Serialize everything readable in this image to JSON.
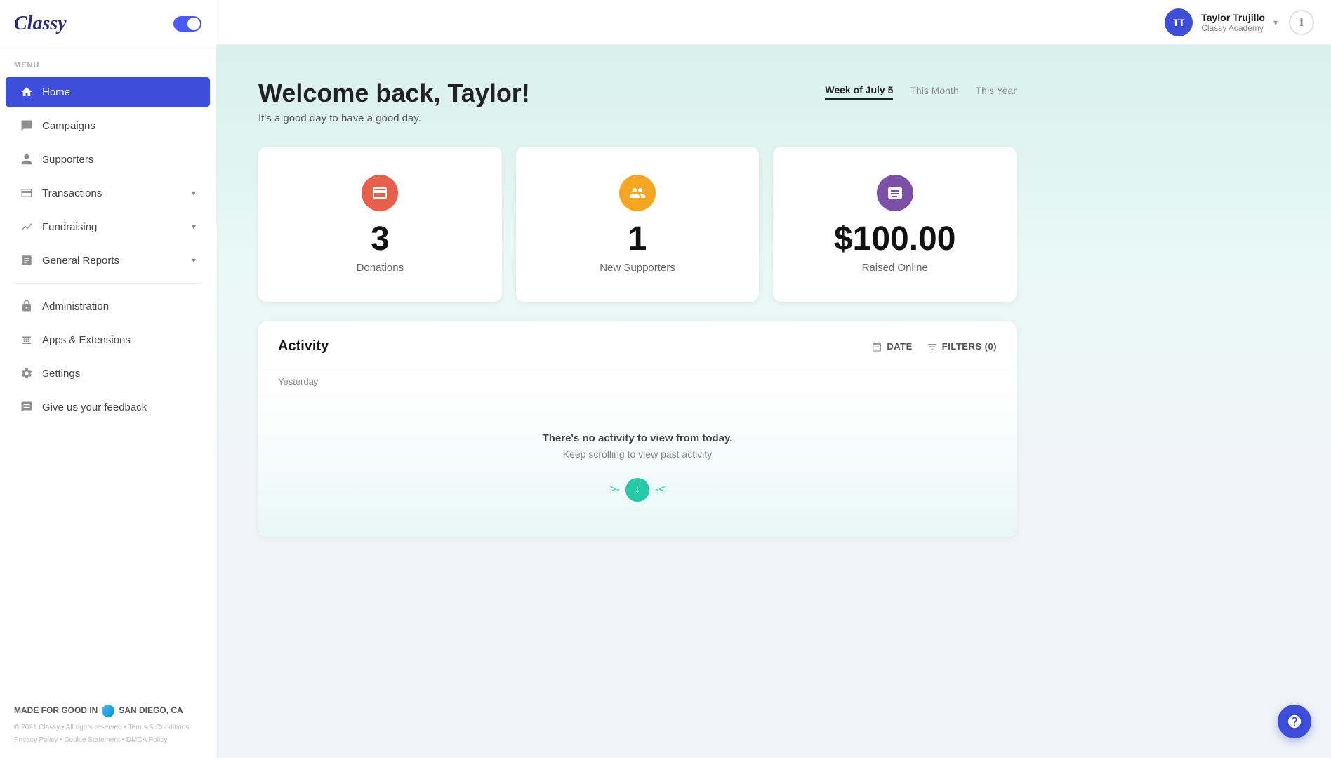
{
  "logo": "Classy",
  "menu_label": "MENU",
  "nav_items": [
    {
      "id": "home",
      "label": "Home",
      "icon": "🏠",
      "active": true
    },
    {
      "id": "campaigns",
      "label": "Campaigns",
      "icon": "📢",
      "active": false
    },
    {
      "id": "supporters",
      "label": "Supporters",
      "icon": "👤",
      "active": false
    },
    {
      "id": "transactions",
      "label": "Transactions",
      "icon": "💳",
      "active": false,
      "has_chevron": true
    },
    {
      "id": "fundraising",
      "label": "Fundraising",
      "icon": "📊",
      "active": false,
      "has_chevron": true
    },
    {
      "id": "general_reports",
      "label": "General Reports",
      "icon": "📄",
      "active": false,
      "has_chevron": true
    }
  ],
  "nav_items_bottom": [
    {
      "id": "administration",
      "label": "Administration",
      "icon": "🔒"
    },
    {
      "id": "apps_extensions",
      "label": "Apps & Extensions",
      "icon": "🔗"
    },
    {
      "id": "settings",
      "label": "Settings",
      "icon": "⚙️"
    },
    {
      "id": "feedback",
      "label": "Give us your feedback",
      "icon": "💬"
    }
  ],
  "footer": {
    "made_for": "MADE FOR GOOD IN",
    "location": "SAN DIEGO, CA",
    "copyright": "© 2021 Classy  •  All rights reserved  •  Terms & Conditions",
    "links": "Privacy Policy  •  Cookie Statement  •  DMCA Policy"
  },
  "user": {
    "initials": "TT",
    "name": "Taylor Trujillo",
    "org": "Classy Academy"
  },
  "welcome": {
    "heading": "Welcome back, Taylor!",
    "subtitle": "It's a good day to have a good day."
  },
  "period_tabs": [
    {
      "id": "week",
      "label": "Week of July 5",
      "active": true
    },
    {
      "id": "month",
      "label": "This Month",
      "active": false
    },
    {
      "id": "year",
      "label": "This Year",
      "active": false
    }
  ],
  "stats": [
    {
      "id": "donations",
      "value": "3",
      "label": "Donations",
      "icon_color": "red",
      "icon": "🧾"
    },
    {
      "id": "new_supporters",
      "value": "1",
      "label": "New Supporters",
      "icon_color": "yellow",
      "icon": "🤝"
    },
    {
      "id": "raised_online",
      "value": "$100.00",
      "label": "Raised Online",
      "icon_color": "purple",
      "icon": "📷"
    }
  ],
  "activity": {
    "title": "Activity",
    "date_btn": "DATE",
    "filters_btn": "FILTERS (0)",
    "section_label": "Yesterday",
    "empty_heading": "There's no activity to view from today.",
    "empty_sub": "Keep scrolling to view past activity"
  }
}
